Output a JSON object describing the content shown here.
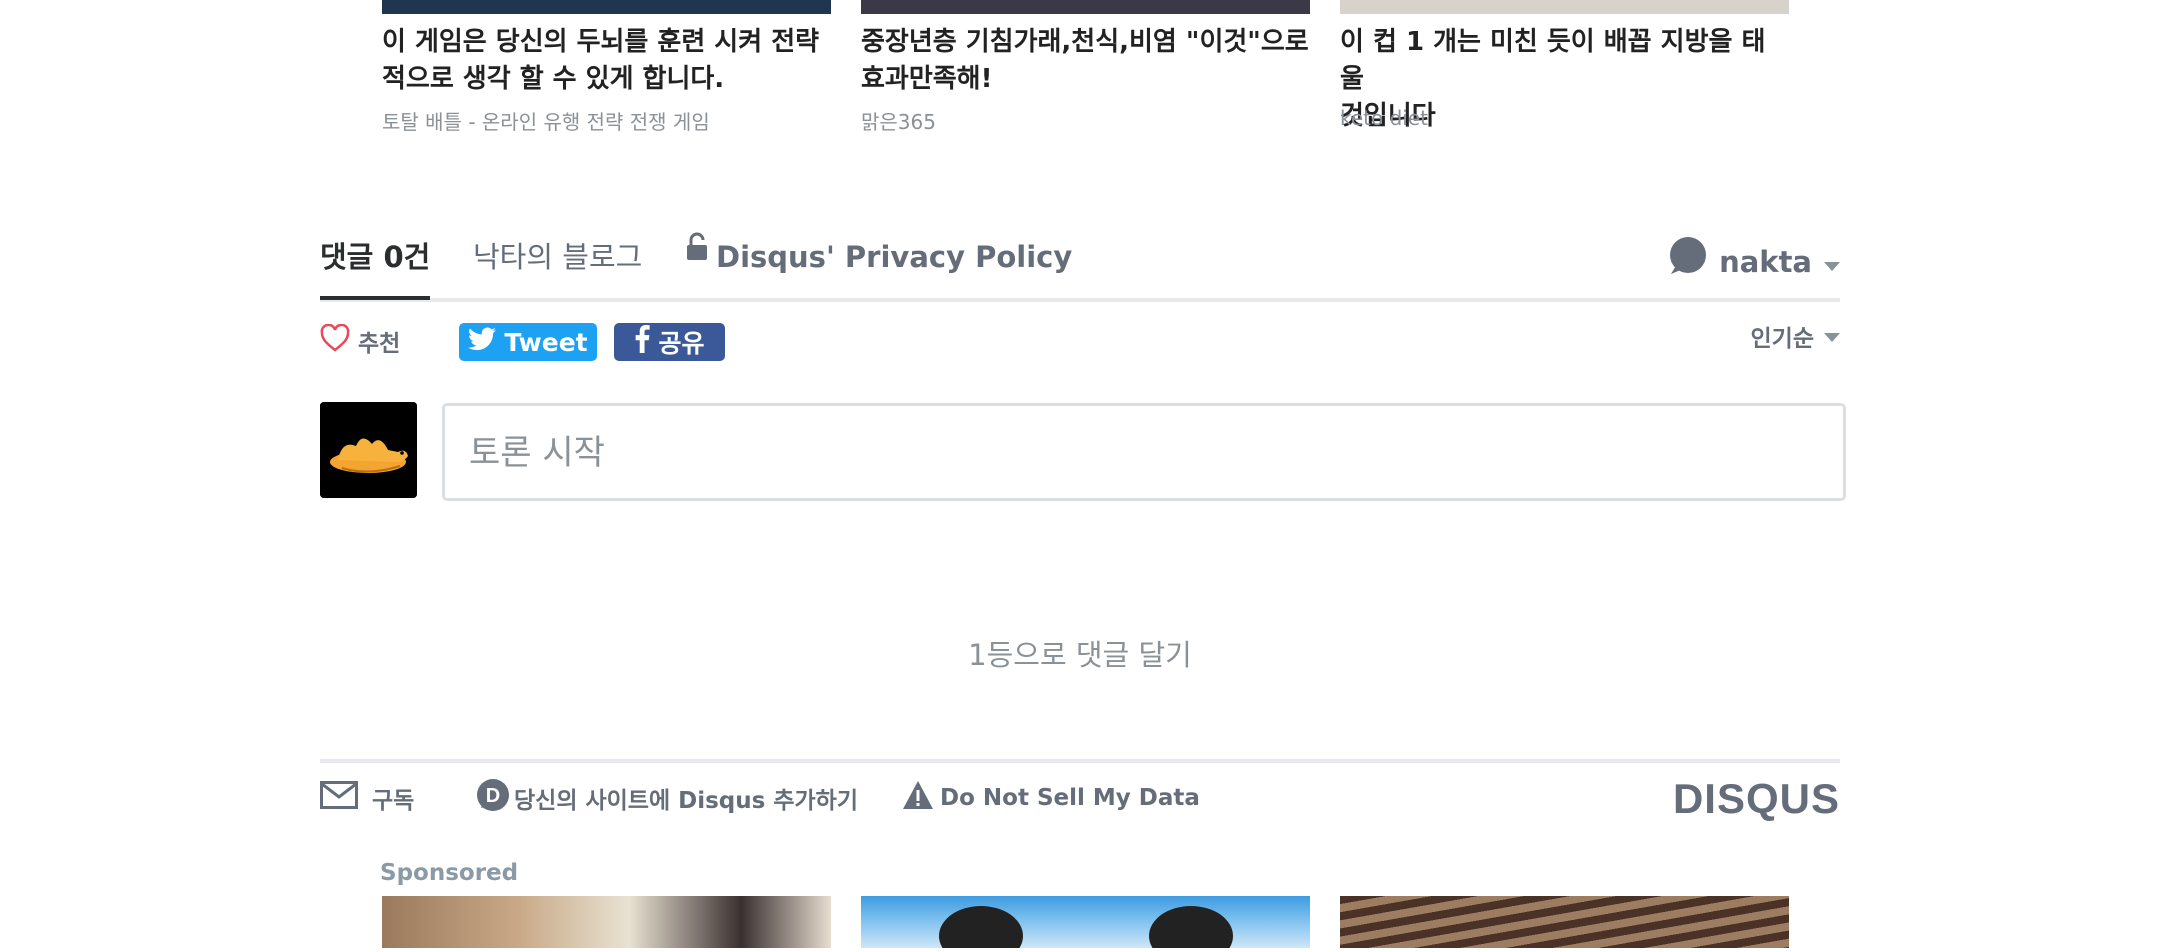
{
  "top_ads": [
    {
      "title_line1": "이 게임은 당신의 두뇌를 훈련 시켜 전략",
      "title_line2": "적으로 생각 할 수 있게 합니다.",
      "source": "토탈 배틀 - 온라인 유행 전략 전쟁 게임",
      "image_color": "#1f3650"
    },
    {
      "title_line1": "중장년층 기침가래,천식,비염 \"이것\"으로",
      "title_line2": "효과만족해!",
      "source": "맑은365",
      "image_color": "#3b3848"
    },
    {
      "title_line1": "이 컵 1 개는 미친 듯이 배꼽 지방을 태울",
      "title_line2": "것입니다",
      "source": "keto diet",
      "image_color": "#d8d2cc"
    }
  ],
  "tabs": {
    "comments": "댓글 0건",
    "blog": "낙타의 블로그",
    "privacy": "Disqus' Privacy Policy",
    "user": "nakta"
  },
  "actions": {
    "recommend": "추천",
    "tweet": "Tweet",
    "share": "공유",
    "sort": "인기순"
  },
  "composer": {
    "placeholder": "토론 시작"
  },
  "empty_state": "1등으로 댓글 달기",
  "footer": {
    "subscribe": "구독",
    "add_disqus": "당신의 사이트에 Disqus 추가하기",
    "do_not_sell": "Do Not Sell My Data",
    "brand": "DISQUS"
  },
  "sponsored": {
    "label": "Sponsored"
  },
  "colors": {
    "tweet": "#1da1f2",
    "facebook": "#3b5998",
    "heart": "#e8495a",
    "muted": "#656c7a"
  }
}
